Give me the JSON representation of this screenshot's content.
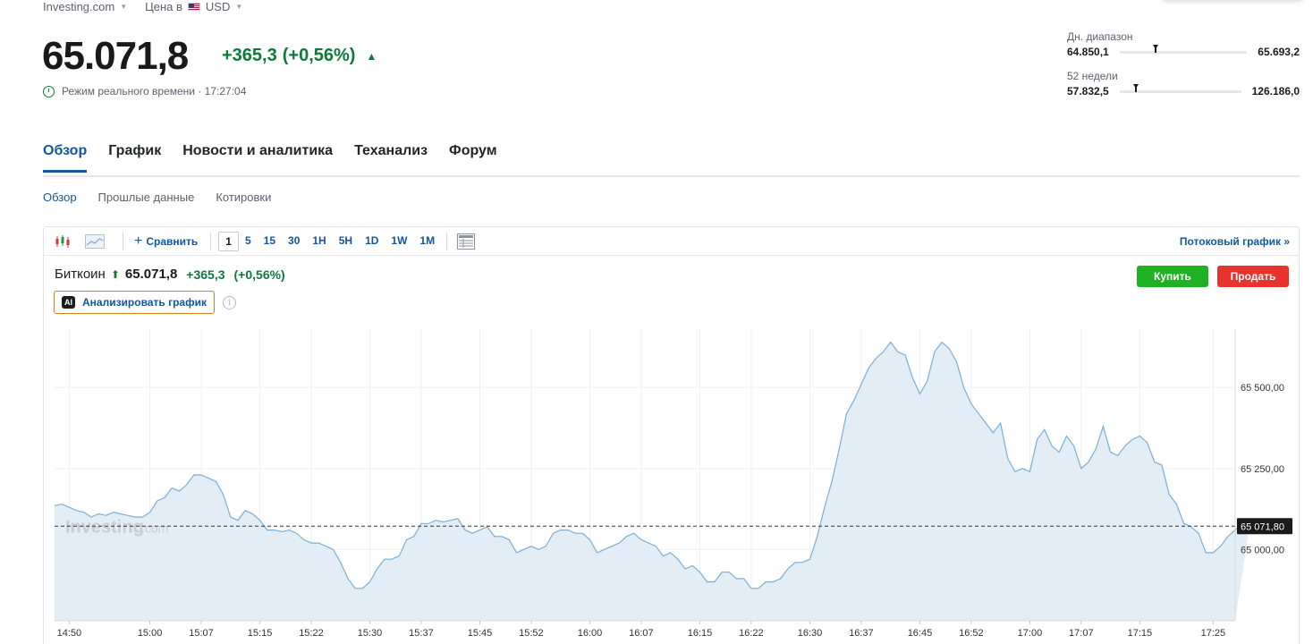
{
  "header": {
    "site": "Investing.com",
    "price_in_label": "Цена в",
    "currency": "USD",
    "price": "65.071,8",
    "change_abs": "+365,3",
    "change_pct": "(+0,56%)",
    "realtime_label": "Режим реального времени · 17:27:04"
  },
  "ranges": {
    "daily": {
      "label": "Дн. диапазон",
      "low": "64.850,1",
      "high": "65.693,2",
      "position": 0.26
    },
    "weeks52": {
      "label": "52 недели",
      "low": "57.832,5",
      "high": "126.186,0",
      "position": 0.11
    }
  },
  "tabs": [
    "Обзор",
    "График",
    "Новости и аналитика",
    "Теханализ",
    "Форум"
  ],
  "subtabs": [
    "Обзор",
    "Прошлые данные",
    "Котировки"
  ],
  "toolbar": {
    "compare_label": "Сравнить",
    "intervals": [
      "1",
      "5",
      "15",
      "30",
      "1H",
      "5H",
      "1D",
      "1W",
      "1M"
    ],
    "selected_interval": "1",
    "stream_label": "Потоковый график",
    "stream_arrow": "»"
  },
  "instrument": {
    "name": "Биткоин",
    "value": "65.071,8",
    "change": "+365,3",
    "change_pct": "(+0,56%)",
    "analyze_badge": "AI",
    "analyze_label": "Анализировать график",
    "buy_label": "Купить",
    "sell_label": "Продать"
  },
  "colors": {
    "positive": "#0c7b38",
    "accent": "#1256a0",
    "buy": "#1eb123",
    "sell": "#e8322e",
    "line": "#7aaed6",
    "area": "#e3edf6"
  },
  "chart_data": {
    "type": "area",
    "watermark": "Investing",
    "watermark_suffix": ".com",
    "current_label": "65 071,80",
    "current_value": 65071.8,
    "y_ticks": [
      {
        "value": 65000,
        "label": "65 000,00"
      },
      {
        "value": 65250,
        "label": "65 250,00"
      },
      {
        "value": 65500,
        "label": "65 500,00"
      }
    ],
    "ylim": [
      64780,
      65680
    ],
    "x_ticks": [
      {
        "index": 2,
        "label": "14:50"
      },
      {
        "index": 13,
        "label": "15:00"
      },
      {
        "index": 20,
        "label": "15:07"
      },
      {
        "index": 28,
        "label": "15:15"
      },
      {
        "index": 35,
        "label": "15:22"
      },
      {
        "index": 43,
        "label": "15:30"
      },
      {
        "index": 50,
        "label": "15:37"
      },
      {
        "index": 58,
        "label": "15:45"
      },
      {
        "index": 65,
        "label": "15:52"
      },
      {
        "index": 73,
        "label": "16:00"
      },
      {
        "index": 80,
        "label": "16:07"
      },
      {
        "index": 88,
        "label": "16:15"
      },
      {
        "index": 95,
        "label": "16:22"
      },
      {
        "index": 103,
        "label": "16:30"
      },
      {
        "index": 110,
        "label": "16:37"
      },
      {
        "index": 118,
        "label": "16:45"
      },
      {
        "index": 125,
        "label": "16:52"
      },
      {
        "index": 133,
        "label": "17:00"
      },
      {
        "index": 140,
        "label": "17:07"
      },
      {
        "index": 148,
        "label": "17:15"
      },
      {
        "index": 158,
        "label": "17:25"
      }
    ],
    "n_points": 162,
    "values": [
      65135,
      65140,
      65130,
      65120,
      65115,
      65100,
      65110,
      65105,
      65115,
      65110,
      65105,
      65100,
      65100,
      65115,
      65150,
      65160,
      65190,
      65180,
      65200,
      65230,
      65230,
      65220,
      65210,
      65170,
      65100,
      65090,
      65120,
      65110,
      65090,
      65060,
      65060,
      65055,
      65060,
      65050,
      65030,
      65020,
      65020,
      65010,
      65000,
      64960,
      64910,
      64880,
      64880,
      64900,
      64940,
      64970,
      64970,
      64980,
      65030,
      65040,
      65080,
      65080,
      65090,
      65085,
      65090,
      65095,
      65060,
      65050,
      65060,
      65070,
      65040,
      65040,
      65030,
      64990,
      65000,
      65010,
      65000,
      65010,
      65050,
      65060,
      65060,
      65050,
      65050,
      65030,
      64990,
      65000,
      65010,
      65020,
      65040,
      65050,
      65030,
      65020,
      65010,
      64980,
      64990,
      64970,
      64940,
      64950,
      64930,
      64900,
      64900,
      64930,
      64930,
      64910,
      64910,
      64880,
      64880,
      64900,
      64900,
      64910,
      64940,
      64960,
      64960,
      64970,
      65040,
      65130,
      65210,
      65310,
      65420,
      65460,
      65510,
      65560,
      65590,
      65610,
      65640,
      65610,
      65600,
      65530,
      65480,
      65520,
      65610,
      65640,
      65620,
      65580,
      65500,
      65450,
      65420,
      65390,
      65360,
      65390,
      65280,
      65240,
      65250,
      65240,
      65340,
      65370,
      65320,
      65300,
      65350,
      65320,
      65250,
      65270,
      65310,
      65380,
      65300,
      65290,
      65320,
      65340,
      65350,
      65330,
      65270,
      65260,
      65170,
      65140,
      65080,
      65070,
      65050,
      64990,
      64990,
      65010,
      65040,
      65060,
      65080,
      65080
    ]
  }
}
